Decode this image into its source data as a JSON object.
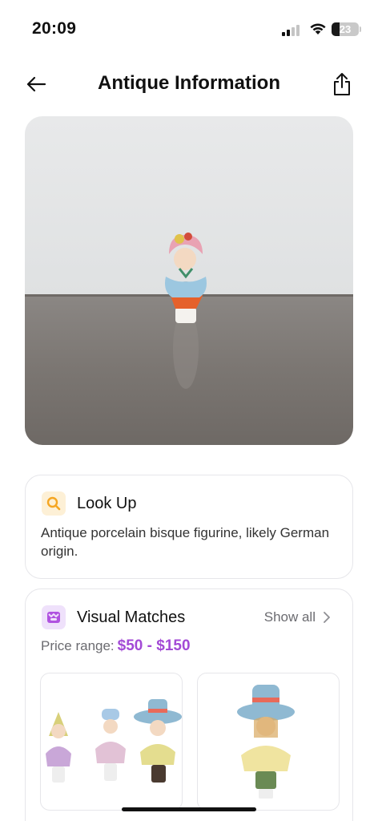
{
  "status": {
    "time": "20:09",
    "battery": "23"
  },
  "header": {
    "title": "Antique Information"
  },
  "lookup": {
    "title": "Look Up",
    "description": "Antique porcelain bisque figurine, likely German origin."
  },
  "visual_matches": {
    "title": "Visual Matches",
    "show_all": "Show all",
    "price_label": "Price range:",
    "price_value": "$50 - $150"
  },
  "icons": {
    "back": "arrow-left-icon",
    "share": "share-icon",
    "lookup": "search-icon",
    "visual": "image-match-icon",
    "chevron": "chevron-right-icon"
  },
  "colors": {
    "accent": "#a34ad6",
    "lookup_icon": "#f5a623",
    "visual_icon": "#b052e0"
  }
}
